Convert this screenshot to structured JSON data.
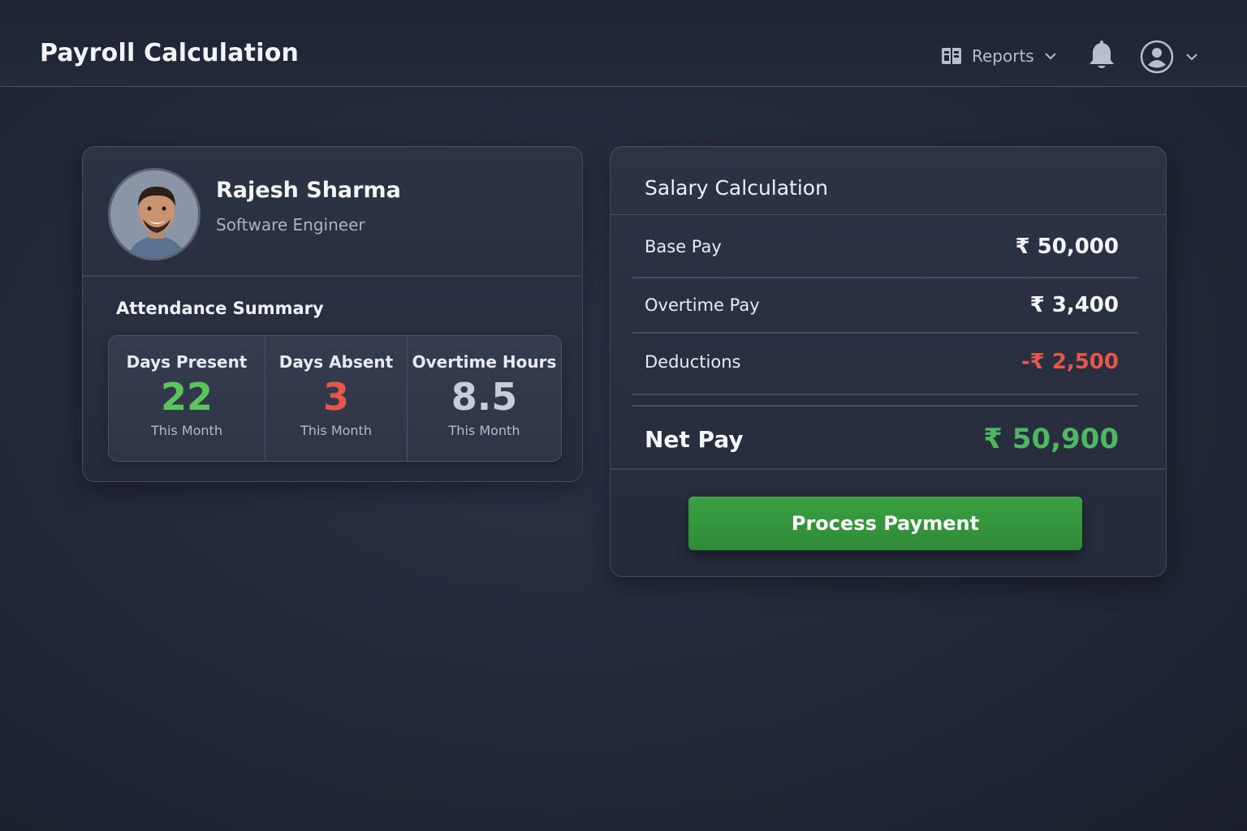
{
  "header": {
    "title": "Payroll Calculation",
    "reports_label": "Reports",
    "reports_icon": "report-book-icon",
    "notification_icon": "bell-icon",
    "user_icon": "user-avatar-icon"
  },
  "employee": {
    "name": "Rajesh Sharma",
    "role": "Software Engineer",
    "photo_icon": "employee-photo"
  },
  "attendance": {
    "title": "Attendance Summary",
    "stats": [
      {
        "label": "Days Present",
        "value": "22",
        "sub": "This Month",
        "color": "#5cc45e"
      },
      {
        "label": "Days Absent",
        "value": "3",
        "sub": "This Month",
        "color": "#e4574a"
      },
      {
        "label": "Overtime Hours",
        "value": "8.5",
        "sub": "This Month",
        "color": "#c8ced8"
      }
    ]
  },
  "salary": {
    "title": "Salary Calculation",
    "base_pay_label": "Base Pay",
    "base_pay_value": "₹ 50,000",
    "overtime_label": "Overtime Pay",
    "overtime_value": "₹ 3,400",
    "deductions_label": "Deductions",
    "deductions_value": "-₹ 2,500",
    "net_label": "Net Pay",
    "net_value": "₹ 50,900",
    "button_label": "Process Payment"
  },
  "colors": {
    "positive": "#4fb761",
    "negative": "#e4574a",
    "button": "#3aa042",
    "background": "#232a3a"
  }
}
